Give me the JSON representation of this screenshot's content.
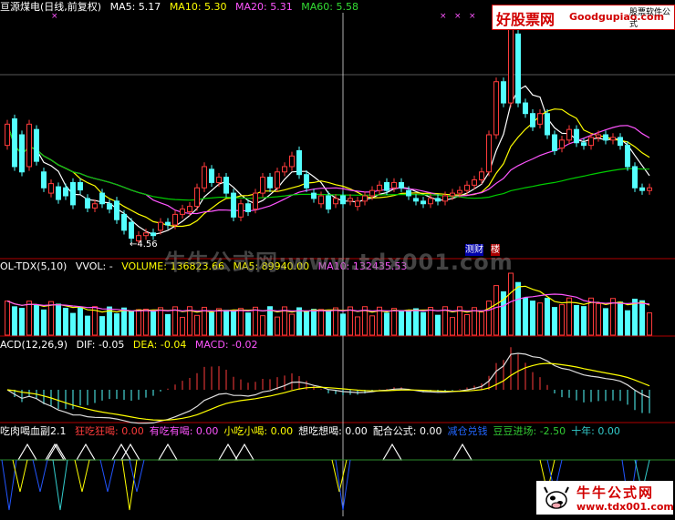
{
  "header": {
    "title": "亘源煤电(日线,前复权)",
    "ma5": "MA5: 5.17",
    "ma10": "MA10: 5.30",
    "ma20": "MA20: 5.31",
    "ma60": "MA60: 5.58",
    "low_marker": "4.56",
    "ca_label": "测",
    "fin_label": "财",
    "lou_label": "楼"
  },
  "volume_row": {
    "name": "OL-TDX(5,10)",
    "vvol": "VVOL: -",
    "volume": "VOLUME: 136823.66",
    "ma5": "MA5: 89940.00",
    "ma10": "MA10: 132435.53"
  },
  "macd_row": {
    "name": "ACD(12,26,9)",
    "dif": "DIF: -0.05",
    "dea": "DEA: -0.04",
    "macd": "MACD: -0.02"
  },
  "indicator_row": {
    "name": "吃肉喝血副2.1",
    "items": [
      {
        "label": "狂吃狂喝: 0.00",
        "color": "#ff3b3b"
      },
      {
        "label": "有吃有喝: 0.00",
        "color": "#ff55ff"
      },
      {
        "label": "小吃小喝: 0.00",
        "color": "#ffff00"
      },
      {
        "label": "想吃想喝: 0.00",
        "color": "#ffffff"
      },
      {
        "label": "配合公式: 0.00",
        "color": "#ffffff"
      },
      {
        "label": "减仓兑钱",
        "color": "#2266ff"
      },
      {
        "label": "豆豆进场: -2.50",
        "color": "#33cc33"
      },
      {
        "label": "十年: 0.00",
        "color": "#33cccc"
      }
    ]
  },
  "watermark": "牛牛公式网:www.tdx001.com",
  "logo": {
    "name": "好股票网",
    "domain": "Goodgupiao.com",
    "tagline": "股票软件公式"
  },
  "stamp": {
    "name": "牛牛公式网",
    "url": "www.tdx001.com"
  },
  "colors": {
    "up": "#ff3b3b",
    "down": "#54ffff",
    "ma5": "#ffffff",
    "ma10": "#ffff00",
    "ma20": "#ff55ff",
    "ma60": "#00cc00",
    "separator": "#b00000"
  },
  "chart_data": {
    "type": "candlestick",
    "title": "亘源煤电(日线,前复权)",
    "low_annotation": 4.56,
    "indicators": [
      "MA5",
      "MA10",
      "MA20",
      "MA60",
      "VOLUME",
      "MACD(12,26,9)",
      "吃肉喝血副2.1"
    ],
    "candles": [
      {
        "o": 6.4,
        "c": 6.8
      },
      {
        "o": 6.9,
        "c": 6.0
      },
      {
        "o": 6.6,
        "c": 5.9
      },
      {
        "o": 6.0,
        "c": 6.8
      },
      {
        "o": 6.7,
        "c": 6.1
      },
      {
        "o": 5.9,
        "c": 5.6
      },
      {
        "o": 5.5,
        "c": 5.68
      },
      {
        "o": 5.62,
        "c": 5.38
      },
      {
        "o": 5.6,
        "c": 5.45
      },
      {
        "o": 5.7,
        "c": 5.28
      },
      {
        "o": 5.7,
        "c": 5.56
      },
      {
        "o": 5.4,
        "c": 5.22
      },
      {
        "o": 5.22,
        "c": 5.3
      },
      {
        "o": 5.5,
        "c": 5.3
      },
      {
        "o": 5.3,
        "c": 5.2
      },
      {
        "o": 5.35,
        "c": 5.0
      },
      {
        "o": 5.1,
        "c": 4.8
      },
      {
        "o": 4.95,
        "c": 4.65
      },
      {
        "o": 4.6,
        "c": 4.7
      },
      {
        "o": 4.7,
        "c": 4.75
      },
      {
        "o": 4.75,
        "c": 4.7
      },
      {
        "o": 4.8,
        "c": 4.95
      },
      {
        "o": 4.95,
        "c": 4.9
      },
      {
        "o": 4.9,
        "c": 5.1
      },
      {
        "o": 5.1,
        "c": 5.2
      },
      {
        "o": 5.15,
        "c": 5.25
      },
      {
        "o": 5.25,
        "c": 5.6
      },
      {
        "o": 5.6,
        "c": 6.0
      },
      {
        "o": 5.95,
        "c": 5.7
      },
      {
        "o": 5.7,
        "c": 5.8
      },
      {
        "o": 5.8,
        "c": 5.5
      },
      {
        "o": 5.5,
        "c": 5.05
      },
      {
        "o": 5.05,
        "c": 5.3
      },
      {
        "o": 5.3,
        "c": 5.15
      },
      {
        "o": 5.2,
        "c": 5.5
      },
      {
        "o": 5.5,
        "c": 5.8
      },
      {
        "o": 5.8,
        "c": 5.6
      },
      {
        "o": 5.6,
        "c": 5.9
      },
      {
        "o": 5.9,
        "c": 6.0
      },
      {
        "o": 6.0,
        "c": 6.2
      },
      {
        "o": 6.3,
        "c": 5.85
      },
      {
        "o": 5.85,
        "c": 5.6
      },
      {
        "o": 5.5,
        "c": 5.4
      },
      {
        "o": 5.3,
        "c": 5.45
      },
      {
        "o": 5.45,
        "c": 5.2
      },
      {
        "o": 5.3,
        "c": 5.4
      },
      {
        "o": 5.45,
        "c": 5.3
      },
      {
        "o": 5.35,
        "c": 5.4
      },
      {
        "o": 5.25,
        "c": 5.35
      },
      {
        "o": 5.35,
        "c": 5.45
      },
      {
        "o": 5.45,
        "c": 5.55
      },
      {
        "o": 5.55,
        "c": 5.65
      },
      {
        "o": 5.7,
        "c": 5.55
      },
      {
        "o": 5.6,
        "c": 5.7
      },
      {
        "o": 5.7,
        "c": 5.6
      },
      {
        "o": 5.55,
        "c": 5.45
      },
      {
        "o": 5.4,
        "c": 5.35
      },
      {
        "o": 5.35,
        "c": 5.3
      },
      {
        "o": 5.3,
        "c": 5.4
      },
      {
        "o": 5.4,
        "c": 5.35
      },
      {
        "o": 5.35,
        "c": 5.45
      },
      {
        "o": 5.45,
        "c": 5.5
      },
      {
        "o": 5.5,
        "c": 5.55
      },
      {
        "o": 5.55,
        "c": 5.65
      },
      {
        "o": 5.65,
        "c": 5.75
      },
      {
        "o": 5.75,
        "c": 5.9
      },
      {
        "o": 5.9,
        "c": 6.6
      },
      {
        "o": 6.6,
        "c": 7.6
      },
      {
        "o": 7.6,
        "c": 7.2
      },
      {
        "o": 7.2,
        "c": 8.6
      },
      {
        "o": 8.5,
        "c": 7.2
      },
      {
        "o": 7.2,
        "c": 7.0
      },
      {
        "o": 7.0,
        "c": 6.75
      },
      {
        "o": 6.8,
        "c": 7.0
      },
      {
        "o": 7.0,
        "c": 6.6
      },
      {
        "o": 6.6,
        "c": 6.3
      },
      {
        "o": 6.35,
        "c": 6.5
      },
      {
        "o": 6.5,
        "c": 6.7
      },
      {
        "o": 6.7,
        "c": 6.45
      },
      {
        "o": 6.45,
        "c": 6.4
      },
      {
        "o": 6.4,
        "c": 6.55
      },
      {
        "o": 6.55,
        "c": 6.6
      },
      {
        "o": 6.6,
        "c": 6.5
      },
      {
        "o": 6.5,
        "c": 6.55
      },
      {
        "o": 6.55,
        "c": 6.4
      },
      {
        "o": 6.4,
        "c": 6.0
      },
      {
        "o": 6.0,
        "c": 5.6
      },
      {
        "o": 5.6,
        "c": 5.55
      },
      {
        "o": 5.55,
        "c": 5.6
      }
    ],
    "volume_ma_visible": true,
    "macd_axis_zero": true
  }
}
